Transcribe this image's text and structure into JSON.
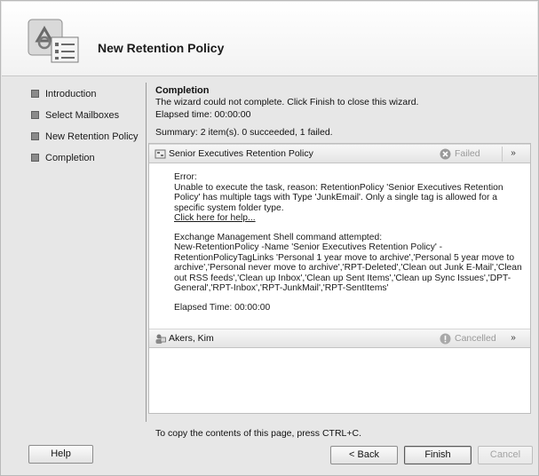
{
  "wizard": {
    "title": "New Retention Policy",
    "icon": "recycle-policy-icon"
  },
  "sidebar": {
    "items": [
      {
        "label": "Introduction"
      },
      {
        "label": "Select Mailboxes"
      },
      {
        "label": "New Retention Policy"
      },
      {
        "label": "Completion"
      }
    ]
  },
  "main": {
    "section_title": "Completion",
    "message": "The wizard could not complete. Click Finish to close this wizard.",
    "elapsed": "Elapsed time: 00:00:00",
    "summary": "Summary: 2 item(s). 0 succeeded, 1 failed."
  },
  "tasks": [
    {
      "name": "Senior Executives Retention Policy",
      "status": "Failed",
      "collapse": "»",
      "error_label": "Error:",
      "error_text": "Unable to execute the task, reason: RetentionPolicy 'Senior Executives Retention Policy' has multiple tags with Type 'JunkEmail'. Only a single tag is allowed for a specific system folder type.",
      "help_link": "Click here for help...",
      "cmd_label": "Exchange Management Shell command attempted:",
      "cmd_text": "New-RetentionPolicy -Name 'Senior Executives Retention Policy' -RetentionPolicyTagLinks 'Personal 1 year move to archive','Personal 5 year move to archive','Personal never move to archive','RPT-Deleted','Clean out Junk E-Mail','Clean out RSS feeds','Clean up Inbox','Clean up Sent Items','Clean up Sync Issues','DPT-General','RPT-Inbox','RPT-JunkMail','RPT-SentItems'",
      "elapsed": "Elapsed Time: 00:00:00"
    },
    {
      "name": "Akers, Kim",
      "status": "Cancelled",
      "collapse": "»"
    }
  ],
  "footer": {
    "copy_note": "To copy the contents of this page, press CTRL+C.",
    "help": "Help",
    "back": "< Back",
    "finish": "Finish",
    "cancel": "Cancel"
  },
  "colors": {
    "failed_icon": "#9a9a9a",
    "cancelled_icon": "#a8a8a8"
  }
}
